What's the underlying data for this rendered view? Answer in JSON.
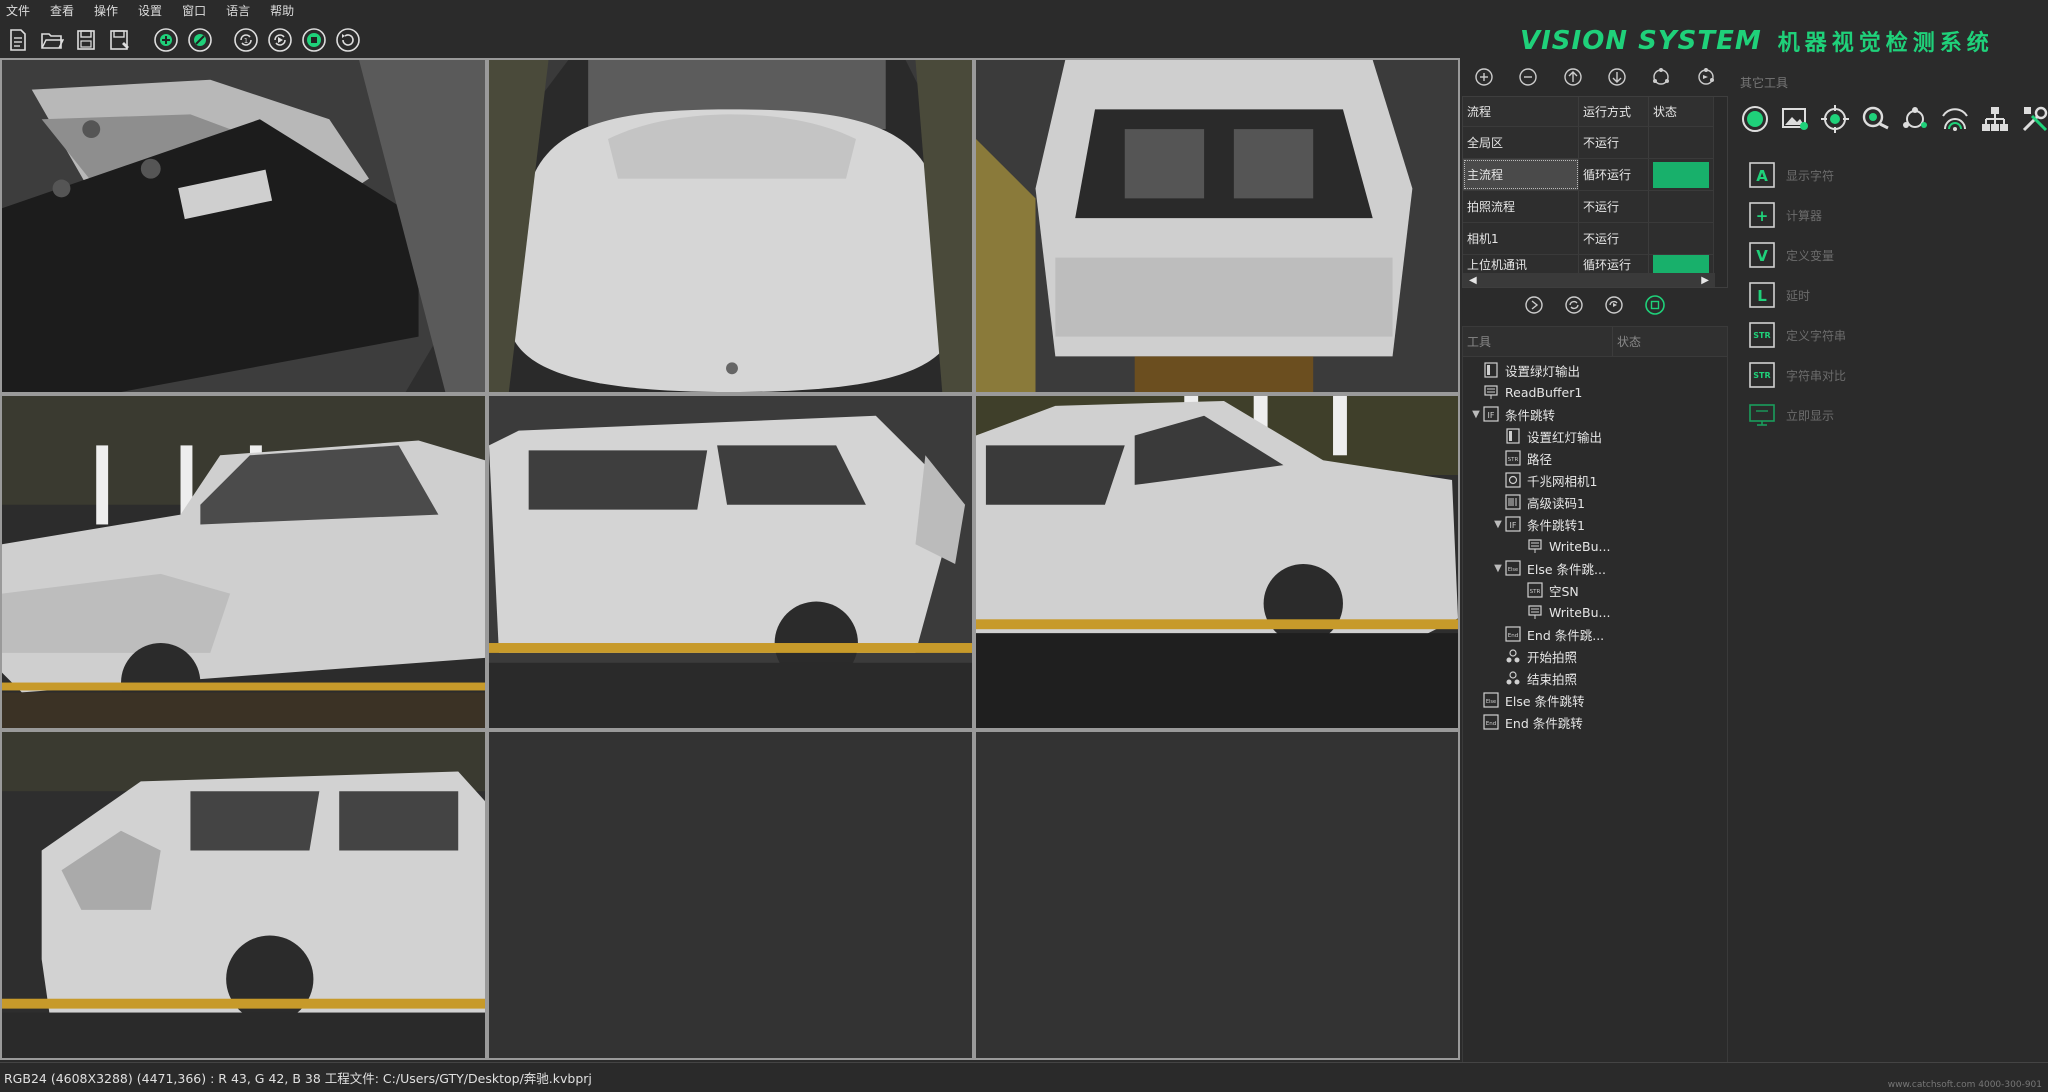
{
  "menu": [
    "文件",
    "查看",
    "操作",
    "设置",
    "窗口",
    "语言",
    "帮助"
  ],
  "toolbar_icons": [
    "new-file-icon",
    "open-folder-icon",
    "save-icon",
    "save-as-icon",
    "add-camera-icon",
    "edit-icon",
    "loop-run-icon",
    "single-run-icon",
    "stop-icon",
    "reset-icon"
  ],
  "brand": {
    "english": "VISION SYSTEM",
    "chinese": "机器视觉检测系统",
    "color": "#1fd17a"
  },
  "process": {
    "controls": [
      "add-icon",
      "remove-icon",
      "move-up-icon",
      "move-down-icon",
      "run-icon",
      "loop-icon"
    ],
    "headers": [
      "流程",
      "运行方式",
      "状态"
    ],
    "rows": [
      {
        "name": "全局区",
        "mode": "不运行",
        "status": ""
      },
      {
        "name": "主流程",
        "mode": "循环运行",
        "status": "green"
      },
      {
        "name": "拍照流程",
        "mode": "不运行",
        "status": ""
      },
      {
        "name": "相机1",
        "mode": "不运行",
        "status": ""
      },
      {
        "name": "上位机通讯",
        "mode": "循环运行",
        "status": "green"
      }
    ]
  },
  "flow_controls": [
    "play-once-icon",
    "loop-icon",
    "cycle-icon",
    "stop-icon"
  ],
  "tools": {
    "headers": [
      "工具",
      "状态"
    ],
    "tree": [
      {
        "label": "设置绿灯输出",
        "indent": 0,
        "toggle": "",
        "icon": "output-icon"
      },
      {
        "label": "ReadBuffer1",
        "indent": 0,
        "toggle": "",
        "icon": "buffer-icon"
      },
      {
        "label": "条件跳转",
        "indent": 0,
        "toggle": "v",
        "icon": "if-icon"
      },
      {
        "label": "设置红灯输出",
        "indent": 1,
        "toggle": "",
        "icon": "output-icon"
      },
      {
        "label": "路径",
        "indent": 1,
        "toggle": "",
        "icon": "str-icon"
      },
      {
        "label": "千兆网相机1",
        "indent": 1,
        "toggle": "",
        "icon": "camera-icon"
      },
      {
        "label": "高级读码1",
        "indent": 1,
        "toggle": "",
        "icon": "barcode-icon"
      },
      {
        "label": "条件跳转1",
        "indent": 1,
        "toggle": "v",
        "icon": "if-icon"
      },
      {
        "label": "WriteBu...",
        "indent": 2,
        "toggle": "",
        "icon": "buffer-icon"
      },
      {
        "label": "Else 条件跳...",
        "indent": 1,
        "toggle": "v",
        "icon": "else-icon"
      },
      {
        "label": "空SN",
        "indent": 2,
        "toggle": "",
        "icon": "str-icon"
      },
      {
        "label": "WriteBu...",
        "indent": 2,
        "toggle": "",
        "icon": "buffer-icon"
      },
      {
        "label": "End 条件跳...",
        "indent": 1,
        "toggle": "",
        "icon": "end-icon"
      },
      {
        "label": "开始拍照",
        "indent": 1,
        "toggle": "",
        "icon": "trigger-icon"
      },
      {
        "label": "结束拍照",
        "indent": 1,
        "toggle": "",
        "icon": "trigger-icon"
      },
      {
        "label": "Else 条件跳转",
        "indent": 0,
        "toggle": "",
        "icon": "else-icon"
      },
      {
        "label": "End 条件跳转",
        "indent": 0,
        "toggle": "",
        "icon": "end-icon"
      }
    ]
  },
  "other_tools": {
    "title": "其它工具",
    "icon_bar": [
      "color-circle-icon",
      "image-icon",
      "target-icon",
      "search-zoom-icon",
      "network-icon",
      "signal-icon",
      "hierarchy-icon",
      "tools-icon"
    ],
    "items": [
      {
        "label": "显示字符",
        "icon": "display-text-icon",
        "letter": "A"
      },
      {
        "label": "计算器",
        "icon": "calculator-icon",
        "letter": "+"
      },
      {
        "label": "定义变量",
        "icon": "variable-icon",
        "letter": "V"
      },
      {
        "label": "延时",
        "icon": "delay-icon",
        "letter": "L"
      },
      {
        "label": "定义字符串",
        "icon": "string-icon",
        "letter": "STR"
      },
      {
        "label": "字符串对比",
        "icon": "string-compare-icon",
        "letter": "STR"
      },
      {
        "label": "立即显示",
        "icon": "monitor-icon",
        "letter": ""
      }
    ]
  },
  "statusbar": {
    "text": "RGB24 (4608X3288) (4471,366) : R 43, G 42, B 38  工程文件: C:/Users/GTY/Desktop/奔驰.kvbprj"
  },
  "watermark": "www.catchsoft.com  4000-300-901",
  "colors": {
    "accent": "#1fd17a",
    "status_green": "#18b06b",
    "background": "#2b2b2b"
  }
}
